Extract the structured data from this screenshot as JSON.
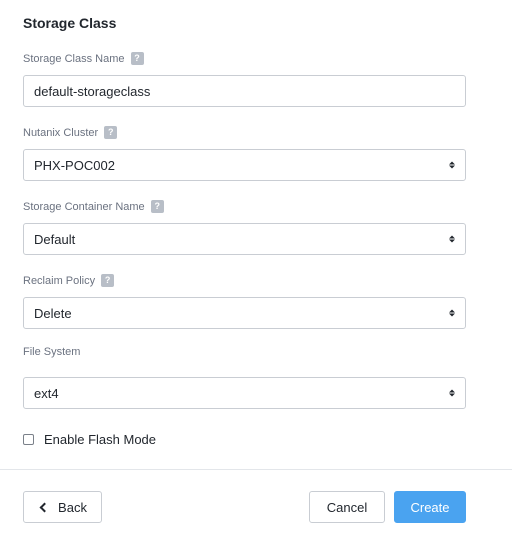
{
  "section": {
    "title": "Storage Class"
  },
  "fields": {
    "storage_class_name": {
      "label": "Storage Class Name",
      "value": "default-storageclass",
      "help": "?"
    },
    "nutanix_cluster": {
      "label": "Nutanix Cluster",
      "value": "PHX-POC002",
      "help": "?"
    },
    "storage_container_name": {
      "label": "Storage Container Name",
      "value": "Default",
      "help": "?"
    },
    "reclaim_policy": {
      "label": "Reclaim Policy",
      "value": "Delete",
      "help": "?"
    },
    "file_system": {
      "label": "File System",
      "value": "ext4"
    }
  },
  "enable_flash_mode": {
    "label": "Enable Flash Mode",
    "checked": false
  },
  "buttons": {
    "back": "Back",
    "cancel": "Cancel",
    "create": "Create"
  },
  "colors": {
    "primary": "#4aa3f0",
    "border": "#c9cdd3",
    "label": "#6b7280"
  }
}
